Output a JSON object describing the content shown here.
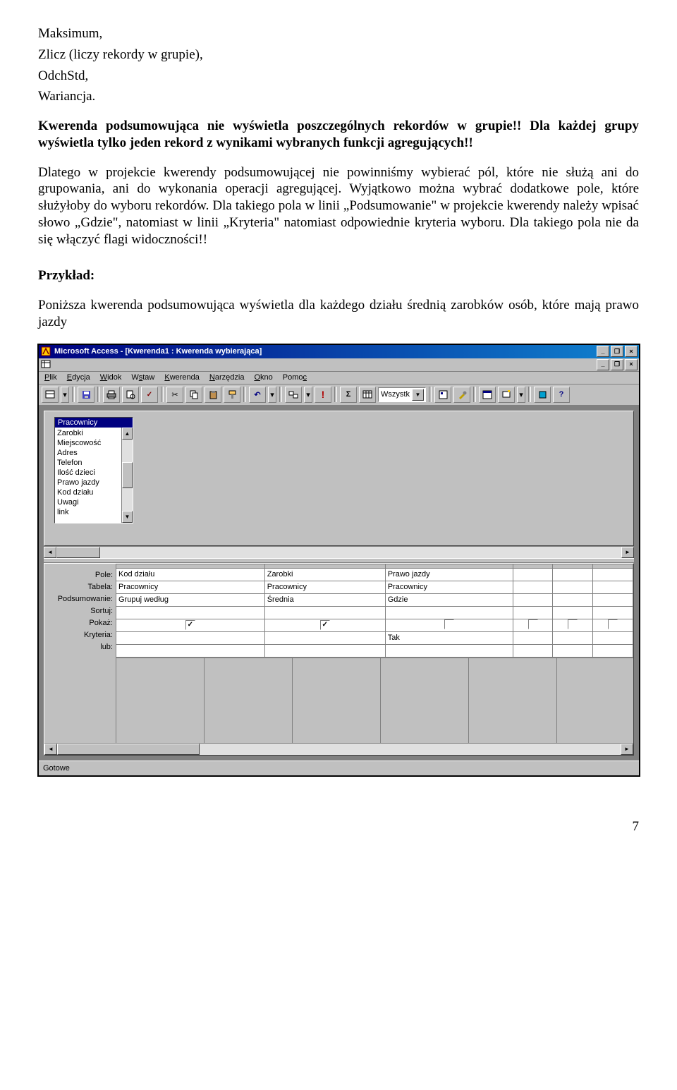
{
  "text": {
    "line1": "Maksimum,",
    "line2": "Zlicz (liczy rekordy w grupie),",
    "line3": "OdchStd,",
    "line4": "Wariancja.",
    "para2": "Kwerenda podsumowująca nie wyświetla poszczególnych rekordów w grupie!! Dla każdej grupy wyświetla tylko jeden rekord z wynikami wybranych funkcji agregujących!!",
    "para3": "Dlatego w projekcie kwerendy podsumowującej nie powinniśmy wybierać pól, które nie służą ani do grupowania, ani do wykonania operacji agregującej. Wyjątkowo można wybrać dodatkowe pole, które służyłoby do wyboru rekordów. Dla takiego pola w linii „Podsumowanie\" w projekcie kwerendy należy wpisać słowo „Gdzie\", natomiast w linii „Kryteria\" natomiast odpowiednie kryteria wyboru. Dla takiego pola nie da się włączyć flagi widoczności!!",
    "example_label": "Przykład:",
    "para4": "Poniższa kwerenda podsumowująca wyświetla dla każdego działu średnią zarobków osób, które mają prawo jazdy",
    "page_number": "7"
  },
  "access": {
    "title": "Microsoft Access - [Kwerenda1 : Kwerenda wybierająca]",
    "menu": [
      "Plik",
      "Edycja",
      "Widok",
      "Wstaw",
      "Kwerenda",
      "Narzędzia",
      "Okno",
      "Pomoc"
    ],
    "toolbar_icons": [
      "sql-view",
      "save",
      "print",
      "print-preview",
      "spellcheck",
      "cut",
      "copy",
      "paste",
      "undo",
      "query-type",
      "run-exclaim",
      "totals-sigma",
      "show-table",
      "top-values",
      "properties",
      "build",
      "database-window",
      "new-object",
      "office",
      "help"
    ],
    "top_values": "Wszystk",
    "table_card": {
      "name": "Pracownicy",
      "fields": [
        "Zarobki",
        "Miejscowość",
        "Adres",
        "Telefon",
        "Ilość dzieci",
        "Prawo jazdy",
        "Kod działu",
        "Uwagi",
        "link"
      ]
    },
    "grid": {
      "row_labels": [
        "Pole:",
        "Tabela:",
        "Podsumowanie:",
        "Sortuj:",
        "Pokaż:",
        "Kryteria:",
        "lub:"
      ],
      "columns": [
        {
          "pole": "Kod działu",
          "tabela": "Pracownicy",
          "podsum": "Grupuj według",
          "pokaz": true,
          "kryteria": ""
        },
        {
          "pole": "Zarobki",
          "tabela": "Pracownicy",
          "podsum": "Średnia",
          "pokaz": true,
          "kryteria": ""
        },
        {
          "pole": "Prawo jazdy",
          "tabela": "Pracownicy",
          "podsum": "Gdzie",
          "pokaz": false,
          "kryteria": "Tak"
        },
        {
          "pole": "",
          "tabela": "",
          "podsum": "",
          "pokaz": false,
          "kryteria": ""
        },
        {
          "pole": "",
          "tabela": "",
          "podsum": "",
          "pokaz": false,
          "kryteria": ""
        },
        {
          "pole": "",
          "tabela": "",
          "podsum": "",
          "pokaz": false,
          "kryteria": ""
        }
      ]
    },
    "status": "Gotowe"
  }
}
